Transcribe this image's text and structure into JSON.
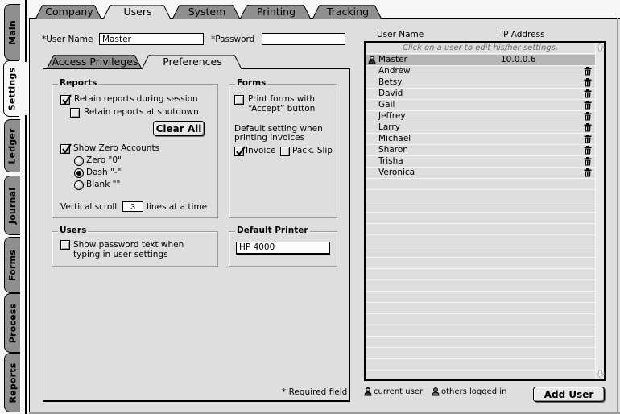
{
  "side_tabs": [
    {
      "label": "Main",
      "active": false
    },
    {
      "label": "Settings",
      "active": true
    },
    {
      "label": "Ledger",
      "active": false
    },
    {
      "label": "Journal",
      "active": false
    },
    {
      "label": "Forms",
      "active": false
    },
    {
      "label": "Process",
      "active": false
    },
    {
      "label": "Reports",
      "active": false
    }
  ],
  "top_tabs": [
    {
      "label": "Company",
      "active": false
    },
    {
      "label": "Users",
      "active": true
    },
    {
      "label": "System",
      "active": false
    },
    {
      "label": "Printing",
      "active": false
    },
    {
      "label": "Tracking",
      "active": false
    }
  ],
  "user_form": {
    "username_label": "*User Name",
    "username_value": "Master",
    "password_label": "*Password",
    "password_value": ""
  },
  "sub_tabs": [
    {
      "label": "Access Privileges",
      "active": false
    },
    {
      "label": "Preferences",
      "active": true
    }
  ],
  "reports": {
    "title": "Reports",
    "retain_session_label": "Retain reports during session",
    "retain_session_checked": true,
    "retain_shutdown_label": "Retain reports at shutdown",
    "retain_shutdown_checked": false,
    "clear_all_label": "Clear All",
    "show_zero_label": "Show Zero Accounts",
    "show_zero_checked": true,
    "zero_options": [
      {
        "label": "Zero \"0\"",
        "selected": false
      },
      {
        "label": "Dash \"-\"",
        "selected": true
      },
      {
        "label": "Blank \"\"",
        "selected": false
      }
    ],
    "scroll_prefix": "Vertical scroll",
    "scroll_value": "3",
    "scroll_suffix": "lines at a time"
  },
  "forms": {
    "title": "Forms",
    "print_accept_line1": "Print forms with",
    "print_accept_line2": "“Accept” button",
    "print_accept_checked": false,
    "default_line1": "Default setting when",
    "default_line2": "printing invoices",
    "invoice_label": "Invoice",
    "invoice_checked": true,
    "packslip_label": "Pack. Slip",
    "packslip_checked": false
  },
  "users_group": {
    "title": "Users",
    "show_password_line1": "Show password text when",
    "show_password_line2": "typing in user settings",
    "show_password_checked": false
  },
  "printer": {
    "title": "Default Printer",
    "value": "HP 4000"
  },
  "required_note": "* Required field",
  "user_list": {
    "col_name": "User Name",
    "col_ip": "IP Address",
    "hint": "Click on a user to edit his/her settings.",
    "users": [
      {
        "name": "Master",
        "ip": "10.0.0.6",
        "current": true,
        "deletable": false
      },
      {
        "name": "Andrew",
        "ip": "",
        "current": false,
        "deletable": true
      },
      {
        "name": "Betsy",
        "ip": "",
        "current": false,
        "deletable": true
      },
      {
        "name": "David",
        "ip": "",
        "current": false,
        "deletable": true
      },
      {
        "name": "Gail",
        "ip": "",
        "current": false,
        "deletable": true
      },
      {
        "name": "Jeffrey",
        "ip": "",
        "current": false,
        "deletable": true
      },
      {
        "name": "Larry",
        "ip": "",
        "current": false,
        "deletable": true
      },
      {
        "name": "Michael",
        "ip": "",
        "current": false,
        "deletable": true
      },
      {
        "name": "Sharon",
        "ip": "",
        "current": false,
        "deletable": true
      },
      {
        "name": "Trisha",
        "ip": "",
        "current": false,
        "deletable": true
      },
      {
        "name": "Veronica",
        "ip": "",
        "current": false,
        "deletable": true
      }
    ]
  },
  "legend": {
    "current_user": "current user",
    "others_logged_in": "others logged in"
  },
  "add_user_label": "Add User",
  "colors": {
    "panel_bg": "#dedede",
    "inactive_tab": "#8f8f8f",
    "selected_row": "#b5b5b5",
    "hint_text": "#6a6a6a"
  }
}
